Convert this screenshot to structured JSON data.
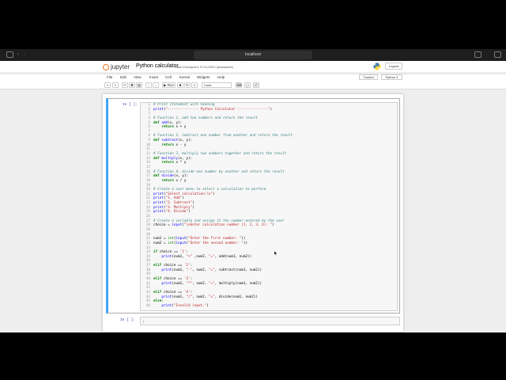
{
  "browser": {
    "url": "localhost"
  },
  "header": {
    "logo_text": "jupyter",
    "notebook_name": "Python calculator",
    "checkpoint": "Last Checkpoint: 07/11/2020  (autosaved)",
    "logout_label": "Logout"
  },
  "menubar": {
    "items": [
      "File",
      "Edit",
      "View",
      "Insert",
      "Cell",
      "Kernel",
      "Widgets",
      "Help"
    ],
    "trusted": "Trusted",
    "kernel": "Python 3"
  },
  "toolbar": {
    "run_label": "▶ Run",
    "cell_type": "Code"
  },
  "cells": {
    "prompt_1": "In [ ]:",
    "prompt_2": "In [ ]:",
    "cell2_line": "1"
  },
  "code_lines": [
    {
      "n": "1",
      "segs": [
        [
          "cm",
          "# Print statement with heading"
        ]
      ]
    },
    {
      "n": "2",
      "segs": [
        [
          "fn",
          "print"
        ],
        [
          "",
          "("
        ],
        [
          "st",
          "\"--------------- Python Calculator ---------------\""
        ],
        [
          "",
          ")"
        ]
      ]
    },
    {
      "n": "3",
      "segs": []
    },
    {
      "n": "4",
      "segs": [
        [
          "cm",
          "# Function 1, add two numbers and return the result"
        ]
      ]
    },
    {
      "n": "5",
      "segs": [
        [
          "kw",
          "def "
        ],
        [
          "fn",
          "add"
        ],
        [
          "",
          "(x, y):"
        ]
      ]
    },
    {
      "n": "6",
      "segs": [
        [
          "",
          "    "
        ],
        [
          "kw",
          "return"
        ],
        [
          "",
          " x + y"
        ]
      ]
    },
    {
      "n": "7",
      "segs": []
    },
    {
      "n": "8",
      "segs": [
        [
          "cm",
          "# Function 2, subtract one number from another and return the result"
        ]
      ]
    },
    {
      "n": "9",
      "segs": [
        [
          "kw",
          "def "
        ],
        [
          "fn",
          "subtract"
        ],
        [
          "",
          "(x, y):"
        ]
      ]
    },
    {
      "n": "10",
      "segs": [
        [
          "",
          "    "
        ],
        [
          "kw",
          "return"
        ],
        [
          "",
          " x - y"
        ]
      ]
    },
    {
      "n": "11",
      "segs": []
    },
    {
      "n": "12",
      "segs": [
        [
          "cm",
          "# Function 3, multiply two numbers together and return the result"
        ]
      ]
    },
    {
      "n": "13",
      "segs": [
        [
          "kw",
          "def "
        ],
        [
          "fn",
          "multiply"
        ],
        [
          "",
          "(x, y):"
        ]
      ]
    },
    {
      "n": "14",
      "segs": [
        [
          "",
          "    "
        ],
        [
          "kw",
          "return"
        ],
        [
          "",
          " x * y"
        ]
      ]
    },
    {
      "n": "15",
      "segs": []
    },
    {
      "n": "16",
      "segs": [
        [
          "cm",
          "# Function 4, divide one number by another and return the result"
        ]
      ]
    },
    {
      "n": "17",
      "segs": [
        [
          "kw",
          "def "
        ],
        [
          "fn",
          "divide"
        ],
        [
          "",
          "(x, y):"
        ]
      ]
    },
    {
      "n": "18",
      "segs": [
        [
          "",
          "    "
        ],
        [
          "kw",
          "return"
        ],
        [
          "",
          " x / y"
        ]
      ]
    },
    {
      "n": "19",
      "segs": []
    },
    {
      "n": "20",
      "segs": [
        [
          "cm",
          "# Create a user menu to select a calculation to perform"
        ]
      ]
    },
    {
      "n": "21",
      "segs": [
        [
          "fn",
          "print"
        ],
        [
          "",
          "("
        ],
        [
          "st",
          "\"Select calculation:\\n\""
        ],
        [
          "",
          ")"
        ]
      ]
    },
    {
      "n": "22",
      "segs": [
        [
          "fn",
          "print"
        ],
        [
          "",
          "("
        ],
        [
          "st",
          "\"1. Add\""
        ],
        [
          "",
          ")"
        ]
      ]
    },
    {
      "n": "23",
      "segs": [
        [
          "fn",
          "print"
        ],
        [
          "",
          "("
        ],
        [
          "st",
          "\"2. Subtract\""
        ],
        [
          "",
          ")"
        ]
      ]
    },
    {
      "n": "24",
      "segs": [
        [
          "fn",
          "print"
        ],
        [
          "",
          "("
        ],
        [
          "st",
          "\"3. Multiply\""
        ],
        [
          "",
          ")"
        ]
      ]
    },
    {
      "n": "25",
      "segs": [
        [
          "fn",
          "print"
        ],
        [
          "",
          "("
        ],
        [
          "st",
          "\"4. Divide\""
        ],
        [
          "",
          ")"
        ]
      ]
    },
    {
      "n": "26",
      "segs": []
    },
    {
      "n": "27",
      "segs": [
        [
          "cm",
          "# Create a variable and assign it the number entered by the user"
        ]
      ]
    },
    {
      "n": "28",
      "segs": [
        [
          "",
          "choice = "
        ],
        [
          "fn",
          "input"
        ],
        [
          "",
          "("
        ],
        [
          "st",
          "\"\\nEnter calculation number (1, 2, 3, 4): \""
        ],
        [
          "",
          ")"
        ]
      ]
    },
    {
      "n": "29",
      "segs": []
    },
    {
      "n": "30",
      "segs": []
    },
    {
      "n": "31",
      "segs": [
        [
          "",
          "num1 = "
        ],
        [
          "bi",
          "int"
        ],
        [
          "",
          "("
        ],
        [
          "fn",
          "input"
        ],
        [
          "",
          "("
        ],
        [
          "st",
          "\"Enter the first number: \""
        ],
        [
          "",
          "))"
        ]
      ]
    },
    {
      "n": "32",
      "segs": [
        [
          "",
          "num2 = "
        ],
        [
          "bi",
          "int"
        ],
        [
          "",
          "("
        ],
        [
          "fn",
          "input"
        ],
        [
          "",
          "("
        ],
        [
          "st",
          "\"Enter the second number: \""
        ],
        [
          "",
          "))"
        ]
      ]
    },
    {
      "n": "33",
      "segs": []
    },
    {
      "n": "34",
      "segs": [
        [
          "kw",
          "if"
        ],
        [
          "",
          " choice == "
        ],
        [
          "st",
          "'1'"
        ],
        [
          "",
          ":"
        ]
      ]
    },
    {
      "n": "35",
      "segs": [
        [
          "",
          "    "
        ],
        [
          "fn",
          "print"
        ],
        [
          "",
          "(num1, "
        ],
        [
          "st",
          "\"+\""
        ],
        [
          "",
          " ,num2, "
        ],
        [
          "st",
          "\"=\""
        ],
        [
          "",
          ", add(num1, num2))"
        ]
      ]
    },
    {
      "n": "36",
      "segs": []
    },
    {
      "n": "37",
      "segs": [
        [
          "kw",
          "elif"
        ],
        [
          "",
          " choice == "
        ],
        [
          "st",
          "'2'"
        ],
        [
          "",
          ":"
        ]
      ]
    },
    {
      "n": "38",
      "segs": [
        [
          "",
          "    "
        ],
        [
          "fn",
          "print"
        ],
        [
          "",
          "(num1, "
        ],
        [
          "st",
          "\"-\""
        ],
        [
          "",
          ", num2, "
        ],
        [
          "st",
          "\"=\""
        ],
        [
          "",
          ", subtract(num1, num2))"
        ]
      ]
    },
    {
      "n": "39",
      "segs": []
    },
    {
      "n": "40",
      "segs": [
        [
          "kw",
          "elif"
        ],
        [
          "",
          " choice == "
        ],
        [
          "st",
          "'3'"
        ],
        [
          "",
          ":"
        ]
      ]
    },
    {
      "n": "41",
      "segs": [
        [
          "",
          "    "
        ],
        [
          "fn",
          "print"
        ],
        [
          "",
          "(num1, "
        ],
        [
          "st",
          "\"*\""
        ],
        [
          "",
          ", num2, "
        ],
        [
          "st",
          "\"=\""
        ],
        [
          "",
          ", multiply(num1, num2))"
        ]
      ]
    },
    {
      "n": "42",
      "segs": []
    },
    {
      "n": "43",
      "segs": [
        [
          "kw",
          "elif"
        ],
        [
          "",
          " choice == "
        ],
        [
          "st",
          "'4'"
        ],
        [
          "",
          ":"
        ]
      ]
    },
    {
      "n": "44",
      "segs": [
        [
          "",
          "    "
        ],
        [
          "fn",
          "print"
        ],
        [
          "",
          "(num1, "
        ],
        [
          "st",
          "\"/\""
        ],
        [
          "",
          ", num2, "
        ],
        [
          "st",
          "\"=\""
        ],
        [
          "",
          ", divide(num1, num2))"
        ]
      ]
    },
    {
      "n": "45",
      "segs": [
        [
          "kw",
          "else"
        ],
        [
          "",
          ":"
        ]
      ]
    },
    {
      "n": "46",
      "segs": [
        [
          "",
          "    "
        ],
        [
          "fn",
          "print"
        ],
        [
          "",
          "("
        ],
        [
          "st",
          "\"Invalid input.\""
        ],
        [
          "",
          ")"
        ]
      ]
    }
  ]
}
